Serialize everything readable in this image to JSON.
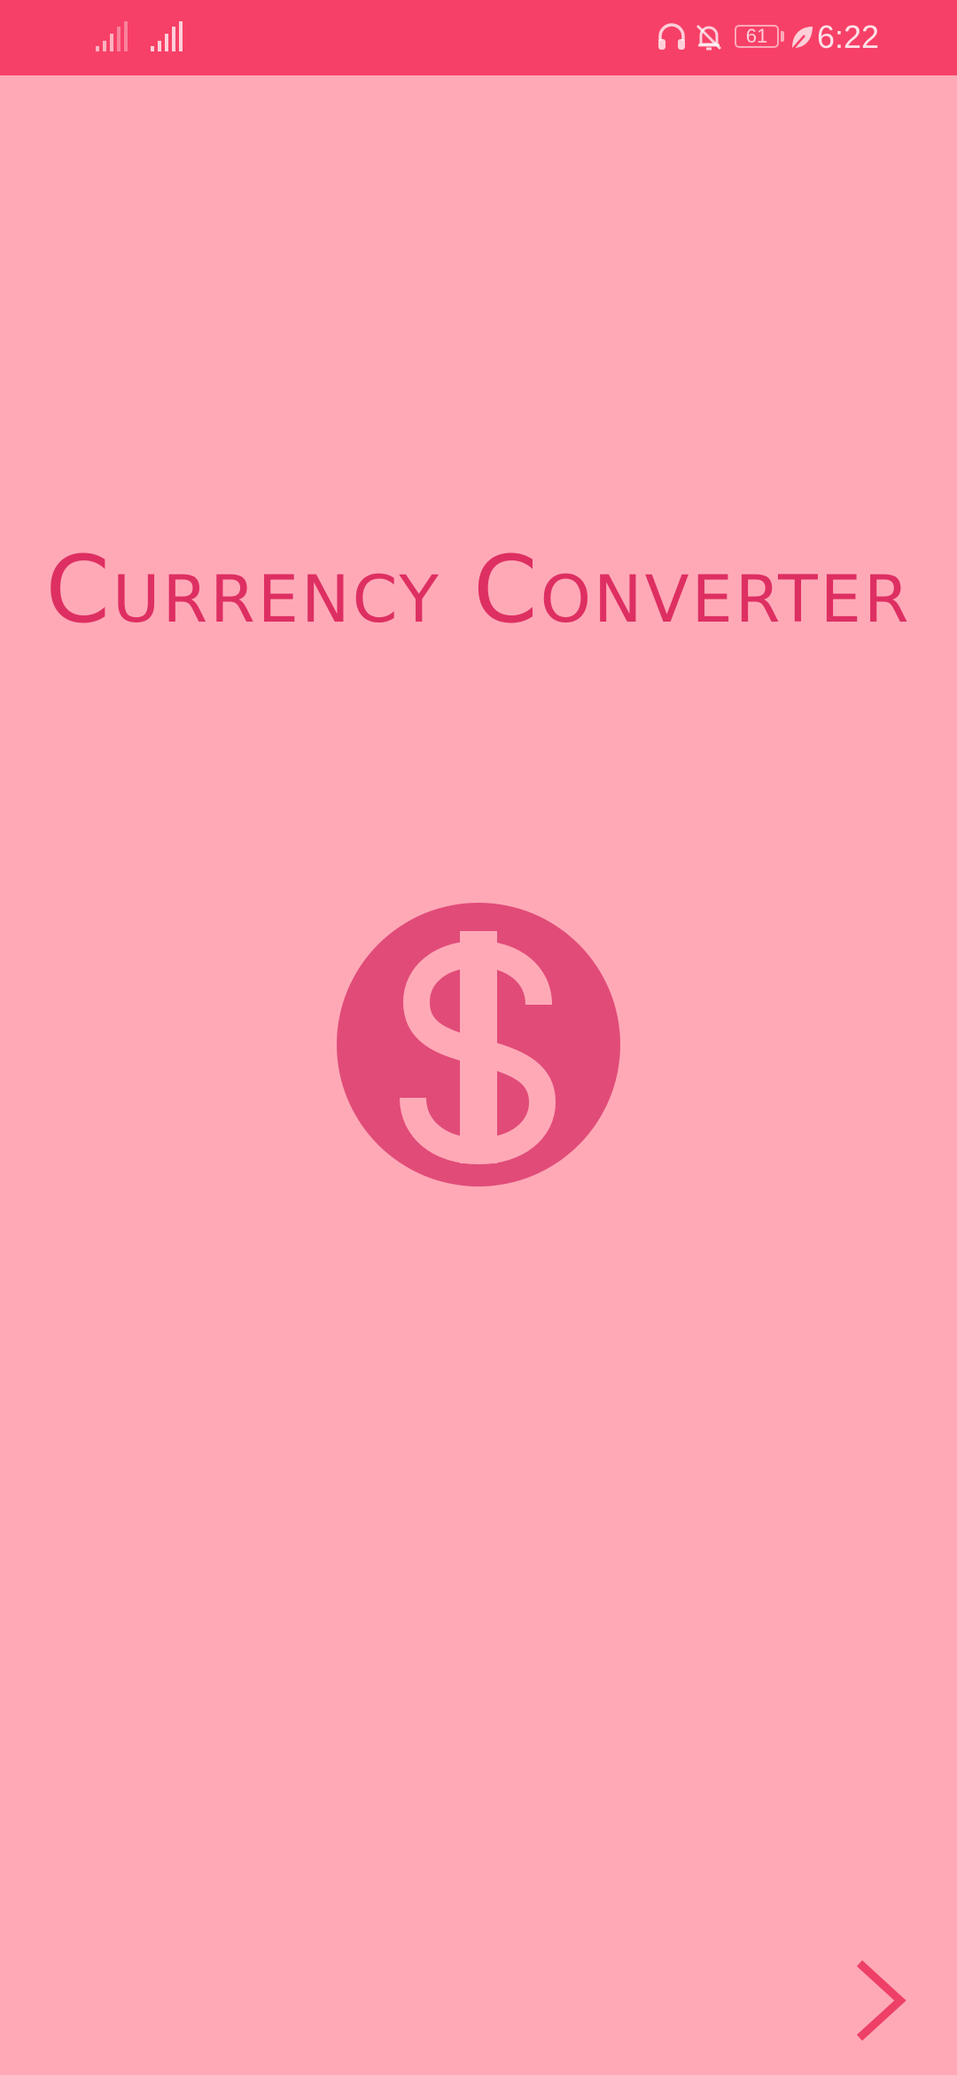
{
  "status_bar": {
    "time": "6:22",
    "battery_level": "61",
    "icons": [
      "signal-icon",
      "signal-icon",
      "headphones-icon",
      "notifications-off-icon",
      "battery-icon",
      "battery-saver-leaf-icon"
    ]
  },
  "splash": {
    "title": "Currency Converter",
    "logo_icon": "dollar-circle-icon",
    "next_icon": "chevron-right-icon"
  },
  "colors": {
    "status_bar": "#F74067",
    "background": "#FFA9B7",
    "title": "#DE2F62",
    "logo_circle": "#E14B78",
    "accent": "#EE3F67"
  }
}
